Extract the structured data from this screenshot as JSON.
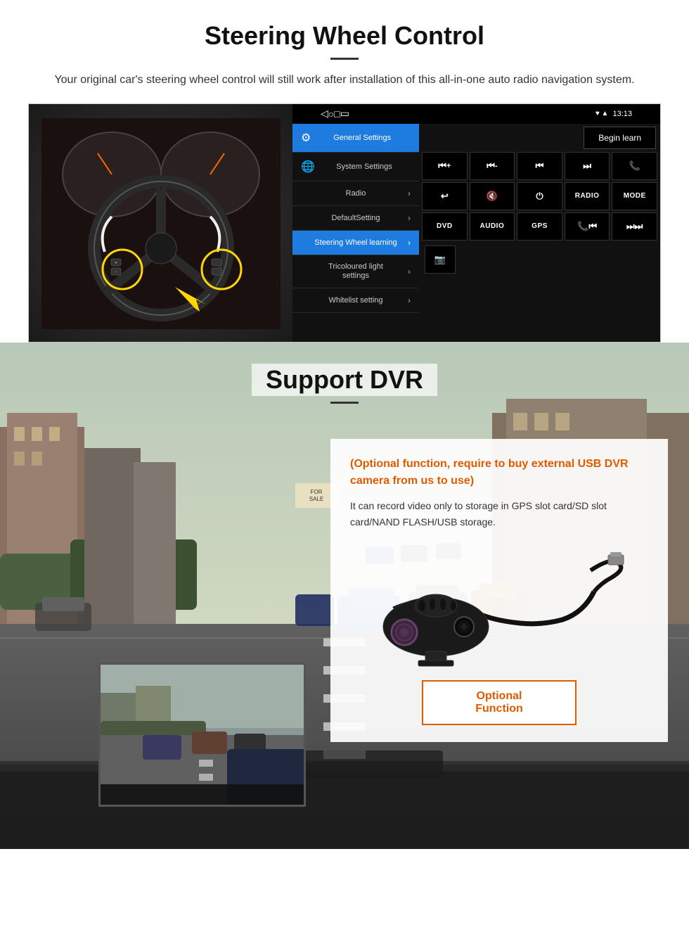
{
  "section1": {
    "title": "Steering Wheel Control",
    "subtitle": "Your original car's steering wheel control will still work after installation of this all-in-one auto radio navigation system.",
    "statusbar": {
      "time": "13:13",
      "icons": "♥ ▲"
    },
    "tabs": {
      "general": "General Settings",
      "system": "System Settings"
    },
    "menu_items": [
      {
        "label": "Radio",
        "active": false
      },
      {
        "label": "DefaultSetting",
        "active": false
      },
      {
        "label": "Steering Wheel learning",
        "active": true
      },
      {
        "label": "Tricoloured light settings",
        "active": false
      },
      {
        "label": "Whitelist setting",
        "active": false
      }
    ],
    "begin_learn": "Begin learn",
    "control_buttons": [
      "⏮+",
      "⏮-",
      "⏮⏮",
      "⏭⏭",
      "📞",
      "↩",
      "🔇",
      "⏻",
      "RADIO",
      "MODE",
      "DVD",
      "AUDIO",
      "GPS",
      "📞⏮",
      "⏭⏭"
    ]
  },
  "section2": {
    "title": "Support DVR",
    "optional_text": "(Optional function, require to buy external USB DVR camera from us to use)",
    "description": "It can record video only to storage in GPS slot card/SD slot card/NAND FLASH/USB storage.",
    "optional_button": "Optional Function"
  }
}
